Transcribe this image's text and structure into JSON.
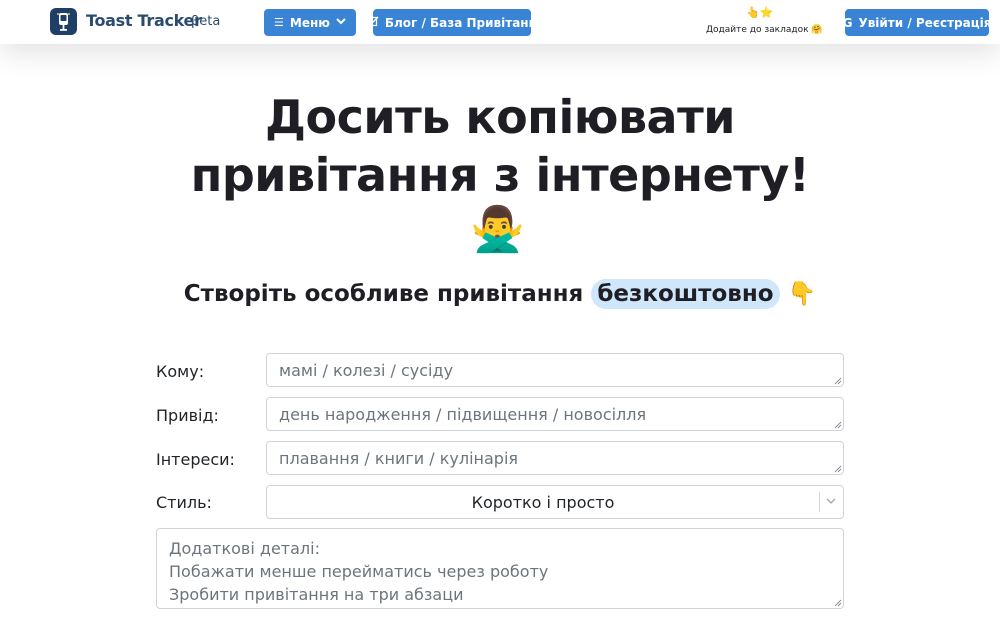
{
  "header": {
    "brand_name": "Toast Tracker",
    "brand_badge": "βeta",
    "menu_label": "Меню",
    "blog_label": "Блог / База Привітань",
    "bookmark_icons": "👆⭐",
    "bookmark_text": "Додайте до закладок 🤗",
    "login_label": "Увійти / Реєстрація",
    "login_icon": "G",
    "accent_color": "#3a84d6"
  },
  "hero": {
    "title_line1": "Досить копіювати",
    "title_line2": "привітання з інтернету!",
    "emoji": "🙅‍♂️"
  },
  "subtitle": {
    "text": "Створіть особливе привітання ",
    "highlight": "безкоштовно",
    "emoji": "👇"
  },
  "form": {
    "to_label": "Кому:",
    "to_placeholder": "мамі / колезі / сусіду",
    "occasion_label": "Привід:",
    "occasion_placeholder": "день народження / підвищення / новосілля",
    "interests_label": "Інтереси:",
    "interests_placeholder": "плавання / книги / кулінарія",
    "style_label": "Стиль:",
    "style_value": "Коротко і просто",
    "details_lines": [
      "Додаткові деталі:",
      "Побажати менше перейматись через роботу",
      "Зробити привітання на три абзаци"
    ]
  }
}
